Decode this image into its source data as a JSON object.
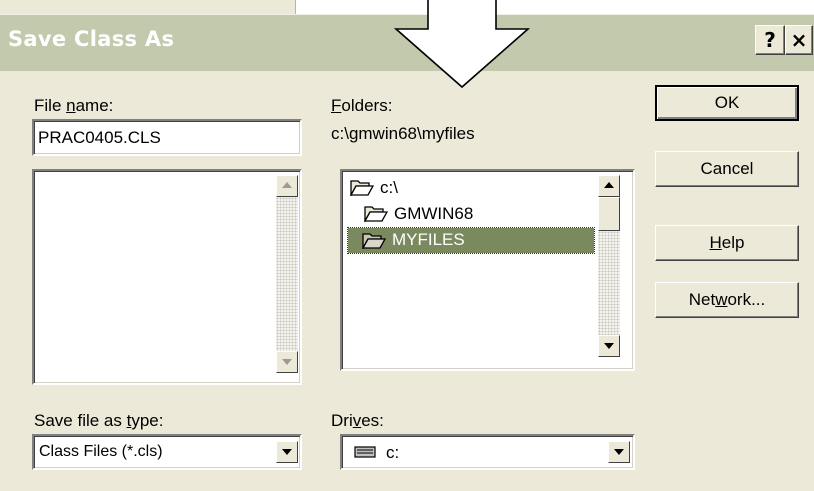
{
  "dialog": {
    "title": "Save Class As",
    "help_button": "?",
    "close_button": "×"
  },
  "file_name": {
    "label_pre": "File ",
    "label_accel": "n",
    "label_post": "ame:",
    "value": "PRAC0405.CLS"
  },
  "folders": {
    "label_accel": "F",
    "label_post": "olders:",
    "path": "c:\\gmwin68\\myfiles",
    "tree": [
      {
        "label": "c:\\",
        "selected": false
      },
      {
        "label": "GMWIN68",
        "selected": false
      },
      {
        "label": "MYFILES",
        "selected": true
      }
    ]
  },
  "save_type": {
    "label_pre": "Save file as ",
    "label_accel": "t",
    "label_post": "ype:",
    "value": "Class Files (*.cls)"
  },
  "drives": {
    "label_pre": "Dri",
    "label_accel": "v",
    "label_post": "es:",
    "value": "c:"
  },
  "buttons": {
    "ok": "OK",
    "cancel": "Cancel",
    "help_accel": "H",
    "help_post": "elp",
    "network_pre": "Net",
    "network_accel": "w",
    "network_post": "ork..."
  },
  "colors": {
    "dialog_bg": "#ece9d8",
    "titlebar": "#c2c9ac",
    "selection": "#7a8a5e"
  }
}
